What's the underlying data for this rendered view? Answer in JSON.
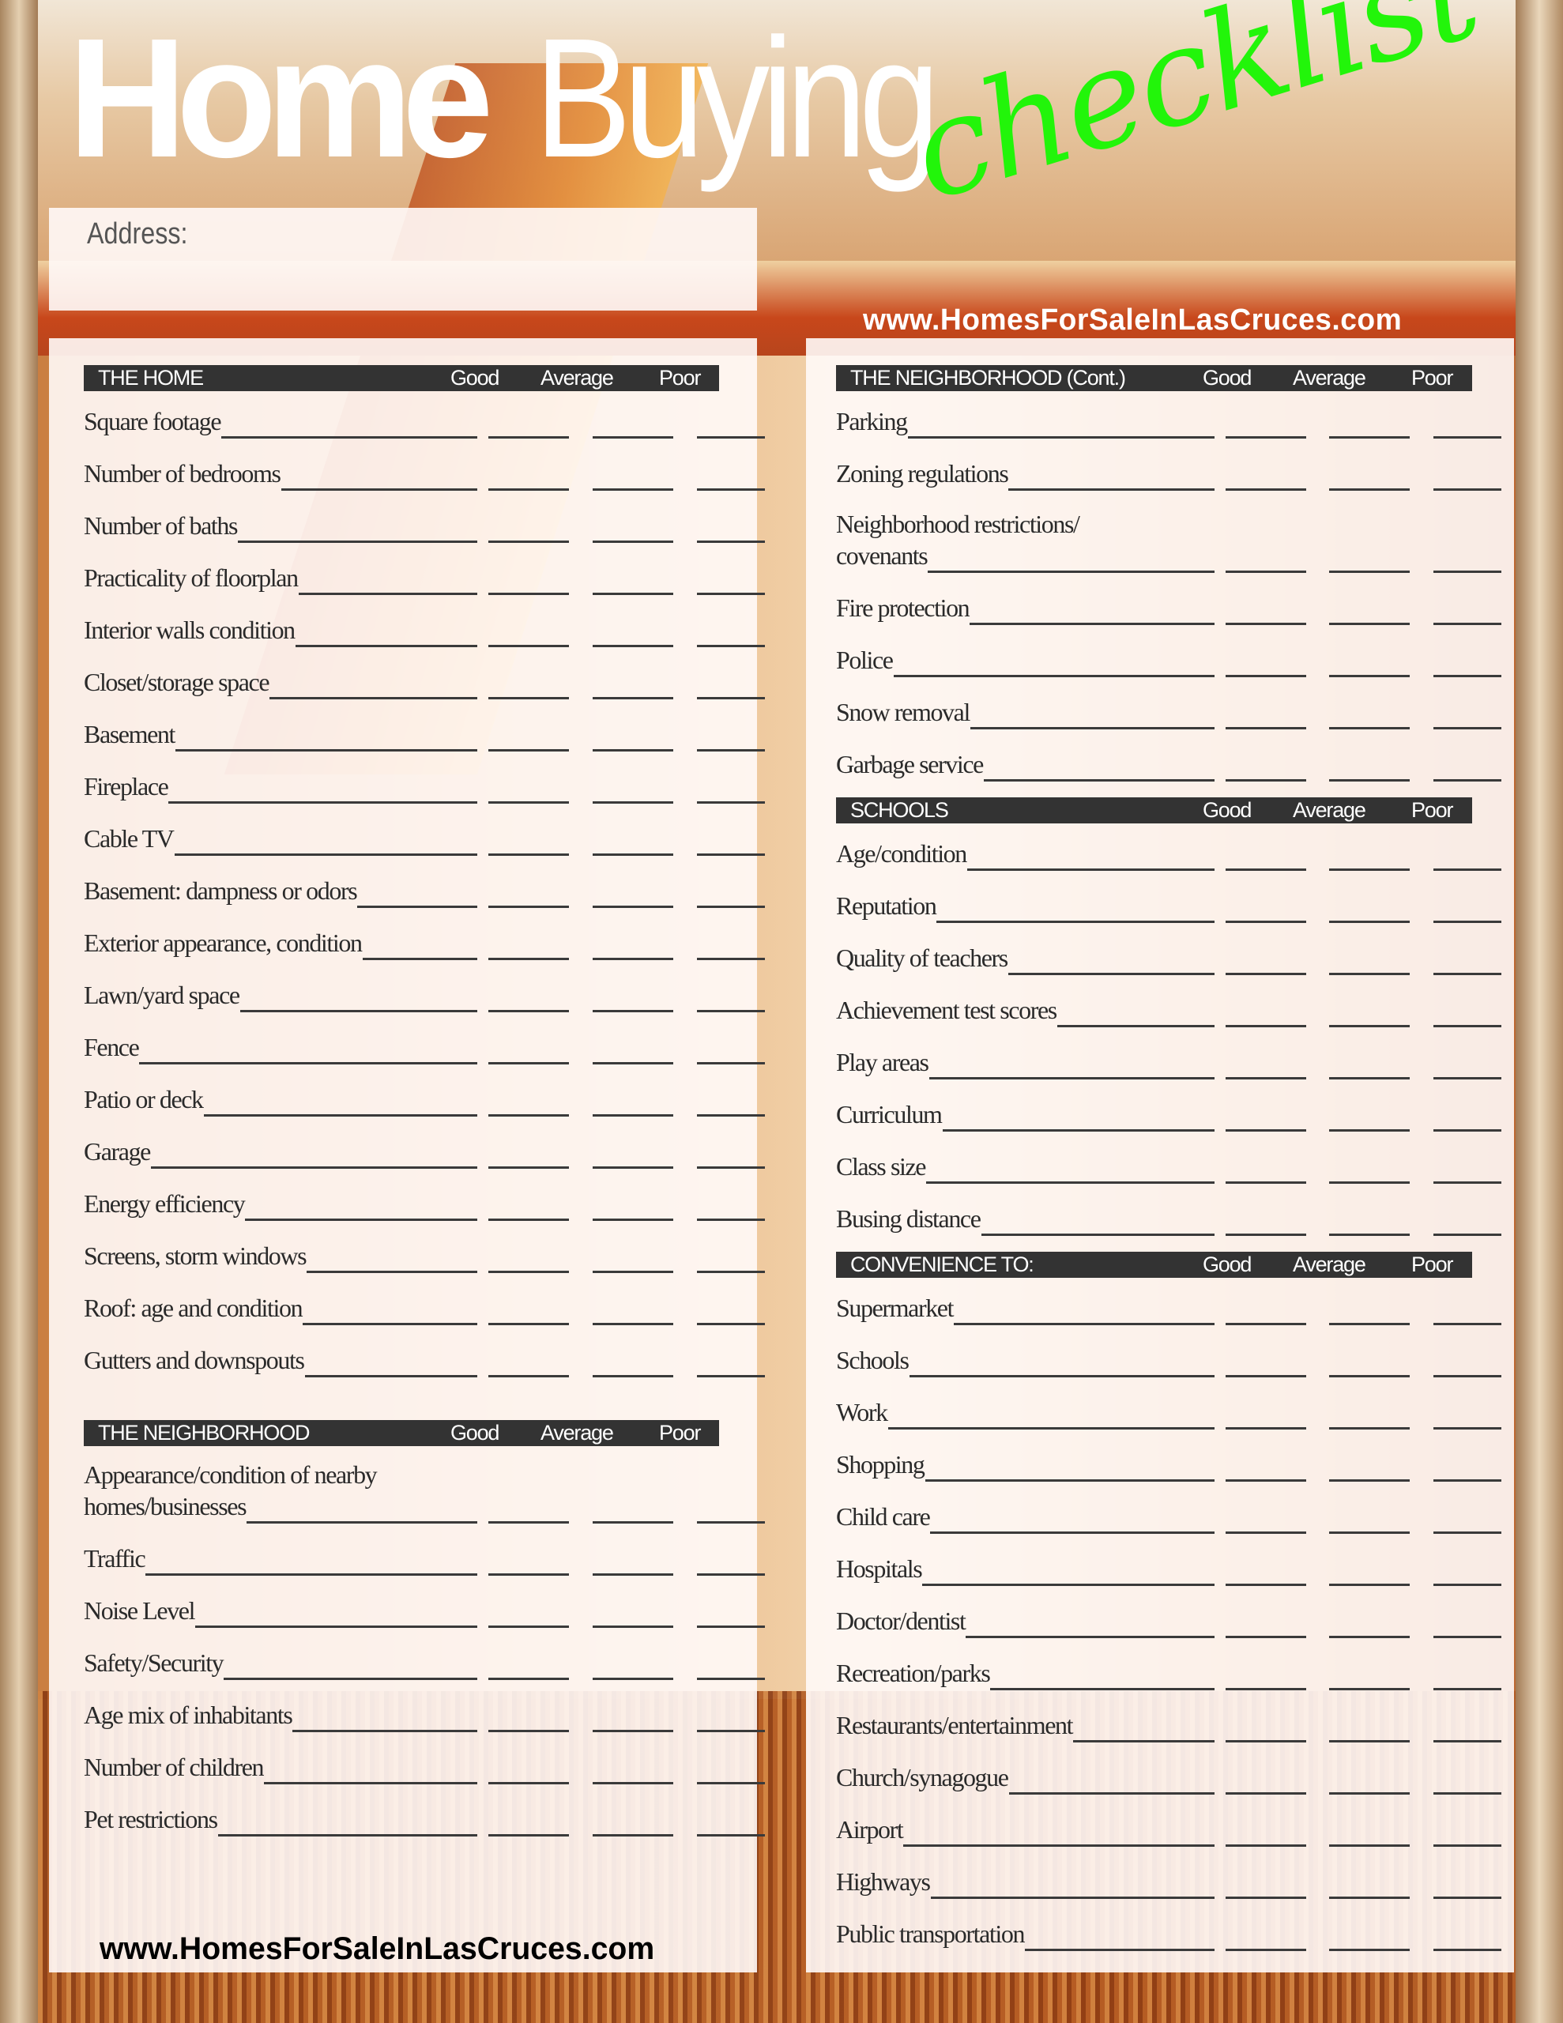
{
  "title": {
    "home": "Home",
    "buying": "Buying",
    "checklist": "checklist"
  },
  "colors": {
    "checklist_accent": "#22f50a",
    "header_bar": "#333333"
  },
  "address": {
    "label": "Address:"
  },
  "website": "www.HomesForSaleInLasCruces.com",
  "rating_columns": [
    "Good",
    "Average",
    "Poor"
  ],
  "sections": {
    "home": {
      "title": "THE HOME",
      "items": [
        "Square footage",
        "Number of bedrooms",
        "Number of baths",
        "Practicality of floorplan",
        "Interior walls condition",
        "Closet/storage space",
        "Basement",
        "Fireplace",
        "Cable TV",
        "Basement: dampness or odors",
        "Exterior appearance, condition",
        "Lawn/yard space",
        "Fence",
        "Patio or deck",
        "Garage",
        "Energy efficiency",
        "Screens, storm windows",
        "Roof: age and condition",
        "Gutters and downspouts"
      ]
    },
    "neighborhood": {
      "title": "THE NEIGHBORHOOD",
      "items": [
        "Appearance/condition of nearby homes/businesses",
        "Traffic",
        "Noise Level",
        "Safety/Security",
        "Age mix of inhabitants",
        "Number of children",
        "Pet restrictions"
      ]
    },
    "neighborhood_cont": {
      "title": "THE NEIGHBORHOOD (Cont.)",
      "items": [
        "Parking",
        "Zoning regulations",
        "Neighborhood restrictions/ covenants",
        "Fire protection",
        "Police",
        "Snow removal",
        "Garbage service"
      ]
    },
    "schools": {
      "title": "SCHOOLS",
      "items": [
        "Age/condition",
        "Reputation",
        "Quality of teachers",
        "Achievement test scores",
        "Play areas",
        "Curriculum",
        "Class size",
        "Busing distance"
      ]
    },
    "convenience": {
      "title": "CONVENIENCE TO:",
      "items": [
        "Supermarket",
        "Schools",
        "Work",
        "Shopping",
        "Child care",
        "Hospitals",
        "Doctor/dentist",
        "Recreation/parks",
        "Restaurants/entertainment",
        "Church/synagogue",
        "Airport",
        "Highways",
        "Public transportation"
      ]
    }
  }
}
